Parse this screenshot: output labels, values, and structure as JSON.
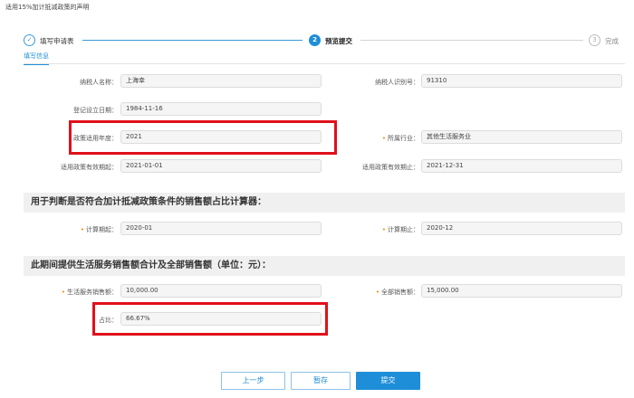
{
  "page": {
    "title": "适用15%加计抵减政策的声明"
  },
  "steps": [
    {
      "num": "✓",
      "label": "填写申请表"
    },
    {
      "num": "2",
      "label": "预览提交"
    },
    {
      "num": "3",
      "label": "完成"
    }
  ],
  "tabs": {
    "active": "填写信息"
  },
  "form": {
    "taxpayer_name": {
      "label": "纳税人名称：",
      "value": "上海幸"
    },
    "taxpayer_id": {
      "label": "纳税人识别号：",
      "value": "91310"
    },
    "reg_date": {
      "label": "登记设立日期：",
      "value": "1984-11-16"
    },
    "policy_year": {
      "label": "政策适用年度：",
      "value": "2021"
    },
    "industry": {
      "label": "所属行业：",
      "value": "其他生活服务业"
    },
    "valid_start": {
      "label": "适用政策有效期起：",
      "value": "2021-01-01"
    },
    "valid_end": {
      "label": "适用政策有效期止：",
      "value": "2021-12-31"
    }
  },
  "section1": {
    "title": "用于判断是否符合加计抵减政策条件的销售额占比计算器：",
    "period_start": {
      "label": "计算期起：",
      "value": "2020-01"
    },
    "period_end": {
      "label": "计算期止：",
      "value": "2020-12"
    }
  },
  "section2": {
    "title": "此期间提供生活服务销售额合计及全部销售额（单位：元）：",
    "life_sales": {
      "label": "生活服务销售额：",
      "value": "10,000.00"
    },
    "total_sales": {
      "label": "全部销售额：",
      "value": "15,000.00"
    },
    "ratio": {
      "label": "占比：",
      "value": "66.67%"
    }
  },
  "buttons": {
    "prev": "上一步",
    "save": "暂存",
    "submit": "提交"
  },
  "colors": {
    "accent": "#1e8ed8",
    "required": "#ff8a00",
    "highlight": "#e0101a"
  }
}
